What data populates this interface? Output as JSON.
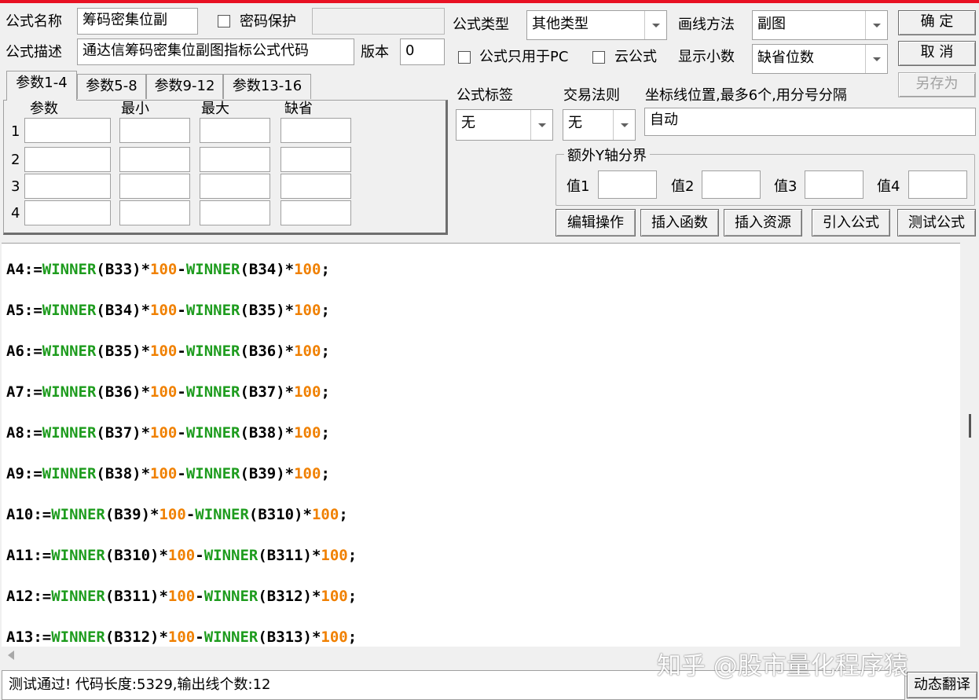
{
  "form": {
    "name_label": "公式名称",
    "name_value": "筹码密集位副",
    "password_label": "密码保护",
    "password_value": "",
    "desc_label": "公式描述",
    "desc_value": "通达信筹码密集位副图指标公式代码",
    "version_label": "版本",
    "version_value": "0",
    "type_label": "公式类型",
    "type_value": "其他类型",
    "draw_label": "画线方法",
    "draw_value": "副图",
    "pc_only_label": "公式只用于PC",
    "cloud_label": "云公式",
    "decimal_label": "显示小数",
    "decimal_value": "缺省位数",
    "tag_label": "公式标签",
    "tag_value": "无",
    "rule_label": "交易法则",
    "rule_value": "无",
    "axis_label": "坐标线位置,最多6个,用分号分隔",
    "axis_value": "自动",
    "yaxis_group": "额外Y轴分界",
    "yaxis_values": [
      "值1",
      "值2",
      "值3",
      "值4"
    ]
  },
  "buttons": {
    "ok": "确  定",
    "cancel": "取  消",
    "save_as": "另存为",
    "edit_ops": "编辑操作",
    "insert_func": "插入函数",
    "insert_res": "插入资源",
    "import_formula": "引入公式",
    "test_formula": "测试公式",
    "translate": "动态翻译"
  },
  "tabs": [
    "参数1-4",
    "参数5-8",
    "参数9-12",
    "参数13-16"
  ],
  "param_headers": [
    "参数",
    "最小",
    "最大",
    "缺省"
  ],
  "param_rows": [
    "1",
    "2",
    "3",
    "4"
  ],
  "code_lines": [
    {
      "lhs": "A4:=",
      "f1": "WINNER",
      "a1": "(B33)*",
      "n1": "100",
      "op": "-",
      "f2": "WINNER",
      "a2": "(B34)*",
      "n2": "100",
      "end": ";"
    },
    {
      "lhs": "A5:=",
      "f1": "WINNER",
      "a1": "(B34)*",
      "n1": "100",
      "op": "-",
      "f2": "WINNER",
      "a2": "(B35)*",
      "n2": "100",
      "end": ";"
    },
    {
      "lhs": "A6:=",
      "f1": "WINNER",
      "a1": "(B35)*",
      "n1": "100",
      "op": "-",
      "f2": "WINNER",
      "a2": "(B36)*",
      "n2": "100",
      "end": ";"
    },
    {
      "lhs": "A7:=",
      "f1": "WINNER",
      "a1": "(B36)*",
      "n1": "100",
      "op": "-",
      "f2": "WINNER",
      "a2": "(B37)*",
      "n2": "100",
      "end": ";"
    },
    {
      "lhs": "A8:=",
      "f1": "WINNER",
      "a1": "(B37)*",
      "n1": "100",
      "op": "-",
      "f2": "WINNER",
      "a2": "(B38)*",
      "n2": "100",
      "end": ";"
    },
    {
      "lhs": "A9:=",
      "f1": "WINNER",
      "a1": "(B38)*",
      "n1": "100",
      "op": "-",
      "f2": "WINNER",
      "a2": "(B39)*",
      "n2": "100",
      "end": ";"
    },
    {
      "lhs": "A10:=",
      "f1": "WINNER",
      "a1": "(B39)*",
      "n1": "100",
      "op": "-",
      "f2": "WINNER",
      "a2": "(B310)*",
      "n2": "100",
      "end": ";"
    },
    {
      "lhs": "A11:=",
      "f1": "WINNER",
      "a1": "(B310)*",
      "n1": "100",
      "op": "-",
      "f2": "WINNER",
      "a2": "(B311)*",
      "n2": "100",
      "end": ";"
    },
    {
      "lhs": "A12:=",
      "f1": "WINNER",
      "a1": "(B311)*",
      "n1": "100",
      "op": "-",
      "f2": "WINNER",
      "a2": "(B312)*",
      "n2": "100",
      "end": ";"
    },
    {
      "lhs": "A13:=",
      "f1": "WINNER",
      "a1": "(B312)*",
      "n1": "100",
      "op": "-",
      "f2": "WINNER",
      "a2": "(B313)*",
      "n2": "100",
      "end": ";"
    }
  ],
  "status": "测试通过! 代码长度:5329,输出线个数:12",
  "watermark": "知乎 @股市量化程序猿",
  "colors": {
    "function": "#1e9c1e",
    "number": "#f08000",
    "title_bar": "#e81123"
  }
}
